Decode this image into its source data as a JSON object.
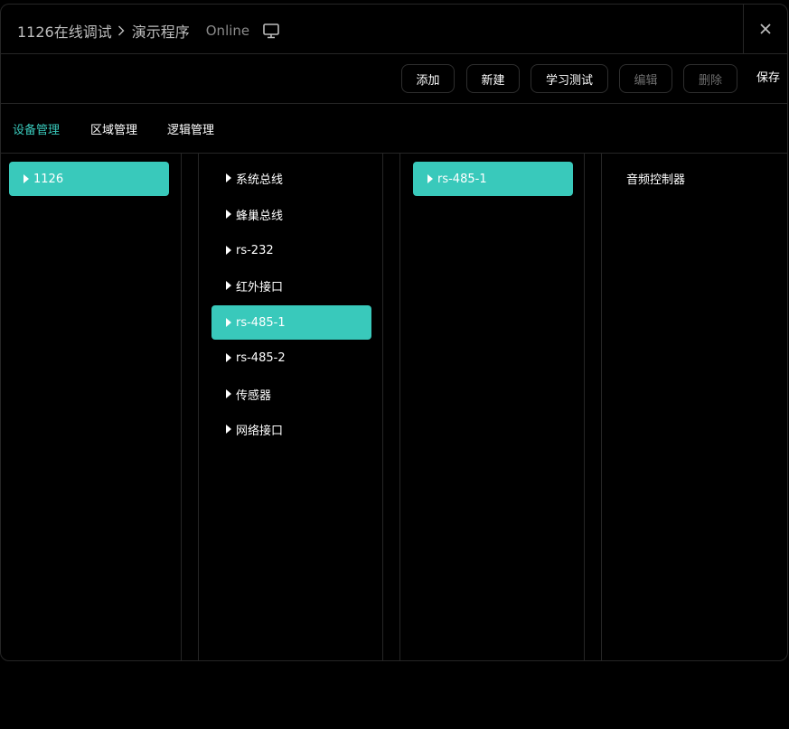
{
  "titlebar": {
    "breadcrumb_root": "1126在线调试",
    "breadcrumb_current": "演示程序",
    "status": "Online"
  },
  "toolbar": {
    "add_label": "添加",
    "new_label": "新建",
    "learn_test_label": "学习测试",
    "edit_label": "编辑",
    "delete_label": "删除",
    "save_label": "保存"
  },
  "tabs": [
    {
      "label": "设备管理",
      "active": true
    },
    {
      "label": "区域管理",
      "active": false
    },
    {
      "label": "逻辑管理",
      "active": false
    }
  ],
  "columns": {
    "devices": [
      "1126"
    ],
    "interfaces": [
      "系统总线",
      "蜂巢总线",
      "rs-232",
      "红外接口",
      "rs-485-1",
      "rs-485-2",
      "传感器",
      "网络接口"
    ],
    "ports": [
      "rs-485-1"
    ],
    "endpoints": [
      "音频控制器"
    ]
  },
  "colors": {
    "accent": "#39c9bb",
    "background": "#000000",
    "border": "#262626"
  }
}
